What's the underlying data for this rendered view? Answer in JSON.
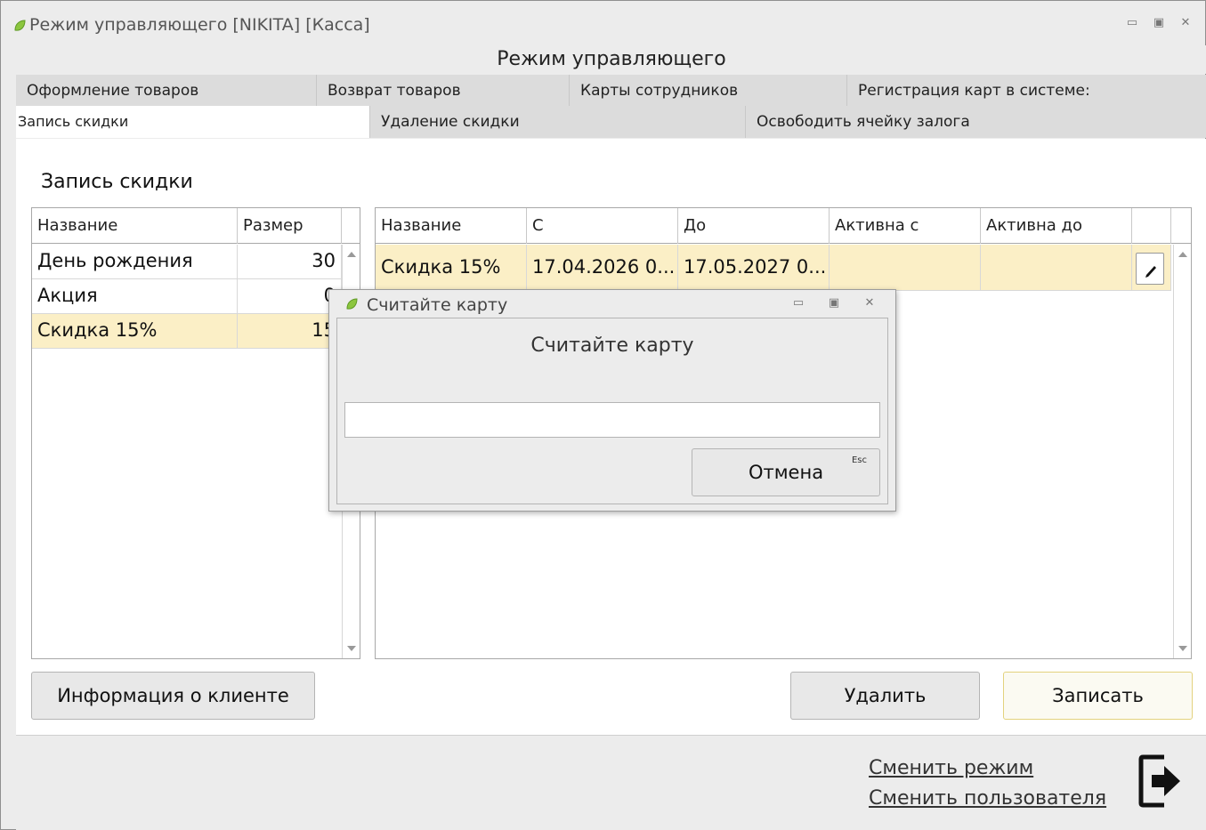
{
  "window": {
    "title": "Режим управляющего [NIKITA] [Касса]",
    "controls": [
      "minimize-icon",
      "maximize-icon",
      "close-icon"
    ]
  },
  "header": {
    "title": "Режим управляющего"
  },
  "tabs_row1": [
    {
      "label": "Оформление товаров"
    },
    {
      "label": "Возврат товаров"
    },
    {
      "label": "Карты сотрудников"
    },
    {
      "label": "Регистрация карт в системе:"
    }
  ],
  "tabs_row2": [
    {
      "label": "Запись скидки",
      "active": true
    },
    {
      "label": "Удаление скидки"
    },
    {
      "label": "Освободить ячейку залога"
    }
  ],
  "section": {
    "title": "Запись скидки"
  },
  "discounts_table": {
    "columns": [
      "Название",
      "Размер"
    ],
    "rows": [
      {
        "name": "День рождения",
        "size": "30"
      },
      {
        "name": "Акция",
        "size": "0"
      },
      {
        "name": "Скидка 15%",
        "size": "15",
        "selected": true
      }
    ]
  },
  "periods_table": {
    "columns": [
      "Название",
      "С",
      "До",
      "Активна с",
      "Активна до"
    ],
    "rows": [
      {
        "name": "Скидка 15%",
        "from": "17.04.2026 0...",
        "to": "17.05.2027 0...",
        "active_from": "",
        "active_to": "",
        "selected": true
      }
    ]
  },
  "buttons": {
    "client_info": "Информация о клиенте",
    "delete": "Удалить",
    "save": "Записать"
  },
  "footer": {
    "change_mode": "Сменить режим",
    "change_user": "Сменить пользователя"
  },
  "dialog": {
    "title": "Считайте карту",
    "header": "Считайте карту",
    "input_value": "",
    "cancel_label": "Отмена",
    "cancel_hotkey": "Esc"
  },
  "colors": {
    "selection": "#fbefc6",
    "primary_button_border": "#e3d27e",
    "leaf_icon": "#8cc63f"
  },
  "icons": [
    "leaf-icon",
    "pencil-icon",
    "exit-icon"
  ]
}
